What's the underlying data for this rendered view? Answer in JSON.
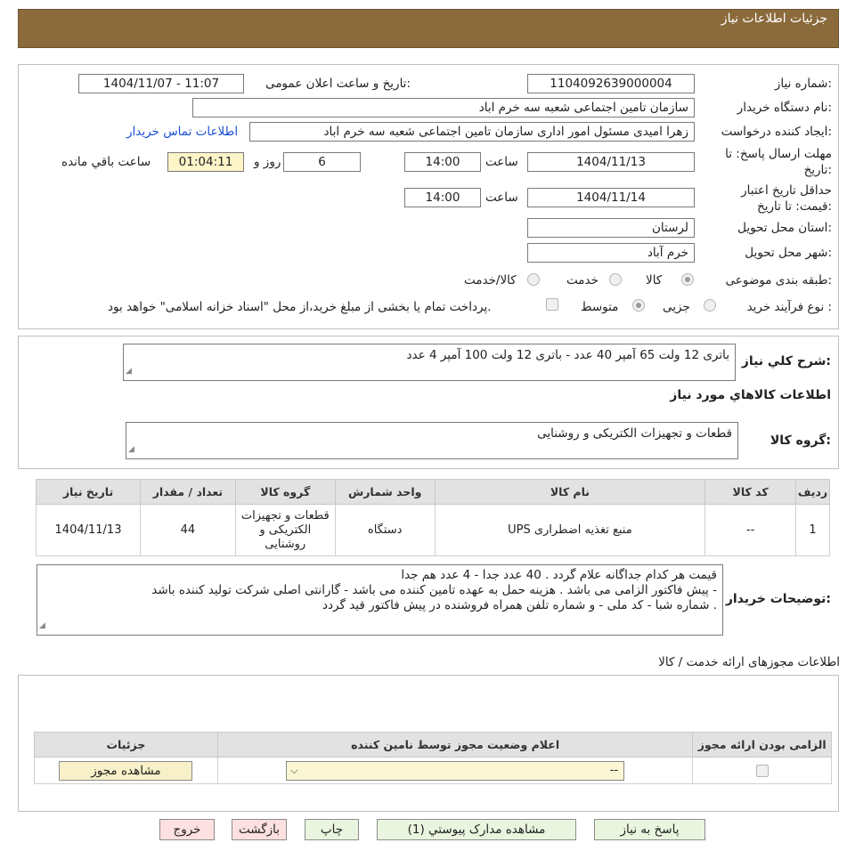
{
  "header": {
    "title": "جزئیات اطلاعات نیاز"
  },
  "form": {
    "need_number_label": "شماره نیاز:",
    "need_number": "1104092639000004",
    "announce_label": "تاریخ و ساعت اعلان عمومی:",
    "announce_value": "1404/11/07 - 11:07",
    "buyer_org_label": "نام دستگاه خریدار:",
    "buyer_org": "سازمان تامین اجتماعی شعبه سه خرم اباد",
    "creator_label": "ایجاد کننده درخواست:",
    "creator": "زهرا امیدی مسئول امور اداری سازمان تامین اجتماعی شعبه سه خرم اباد",
    "contact_link": "اطلاعات تماس خریدار",
    "deadline_label": "مهلت ارسال پاسخ: تا تاریخ:",
    "deadline_date": "1404/11/13",
    "time_label": "ساعت",
    "deadline_time": "14:00",
    "days_value": "6",
    "days_label": "روز و",
    "remaining_time": "01:04:11",
    "remaining_label": "ساعت باقي مانده",
    "validity_label": "حداقل تاریخ اعتبار قیمت: تا تاریخ:",
    "validity_date": "1404/11/14",
    "validity_time": "14:00",
    "province_label": "استان محل تحویل:",
    "province": "لرستان",
    "city_label": "شهر محل تحویل:",
    "city": "خرم آباد",
    "category_label": "طبقه بندی موضوعی:",
    "category_options": [
      "کالا",
      "خدمت",
      "کالا/خدمت"
    ],
    "process_label": "نوع فرآیند خرید :",
    "process_options": [
      "جزیی",
      "متوسط"
    ],
    "payment_note": "پرداخت تمام یا بخشی از مبلغ خرید،از محل \"اسناد خزانه اسلامی\" خواهد بود."
  },
  "summary": {
    "label": "شرح كلي نياز:",
    "text": "باتری 12 ولت 65 آمپر 40 عدد   -  باتری 12 ولت 100 آمپر 4 عدد",
    "goods_info_title": "اطلاعات كالاهاي مورد نياز",
    "goods_group_label": "گروه کالا:",
    "goods_group": "قطعات و تجهیزات الکتریکی و روشنایی"
  },
  "goods_table": {
    "headers": [
      "ردیف",
      "کد کالا",
      "نام کالا",
      "واحد شمارش",
      "گروه کالا",
      "تعداد / مقدار",
      "تاریخ نیاز"
    ],
    "rows": [
      [
        "1",
        "--",
        "منبع تغذیه اضطراری UPS",
        "دستگاه",
        "قطعات و تجهیزات الکتریکی و روشنایی",
        "44",
        "1404/11/13"
      ]
    ]
  },
  "buyer_notes": {
    "label": "توضیحات خریدار:",
    "lines": [
      "قیمت هر کدام جداگانه علام گردد . 40 عدد جدا - 4 عدد هم جدا",
      "پیش فاکتور الزامی می باشد . هزینه حمل به عهده تامین کننده می باشد - گارانتی اصلی شرکت تولید کننده باشد -",
      "شماره شبا - کد ملی - و شماره تلفن همراه فروشنده در پیش فاکتور قید گردد ."
    ]
  },
  "permits": {
    "title": "اطلاعات مجوزهای ارائه خدمت / کالا",
    "headers": [
      "الزامی بودن ارائه مجوز",
      "اعلام وضعیت مجوز توسط نامین کننده",
      "جزئیات"
    ],
    "select_value": "--",
    "view_button": "مشاهده مجوز"
  },
  "footer_buttons": {
    "reply": "پاسخ به نیاز",
    "attachments": "مشاهده مدارک پیوستي (1)",
    "print": "چاپ",
    "back": "بازگشت",
    "exit": "خروج"
  },
  "colors": {
    "header_bg": "#8b6a3c",
    "button_green": "#eaf5df",
    "button_pink": "#fde0e0"
  }
}
